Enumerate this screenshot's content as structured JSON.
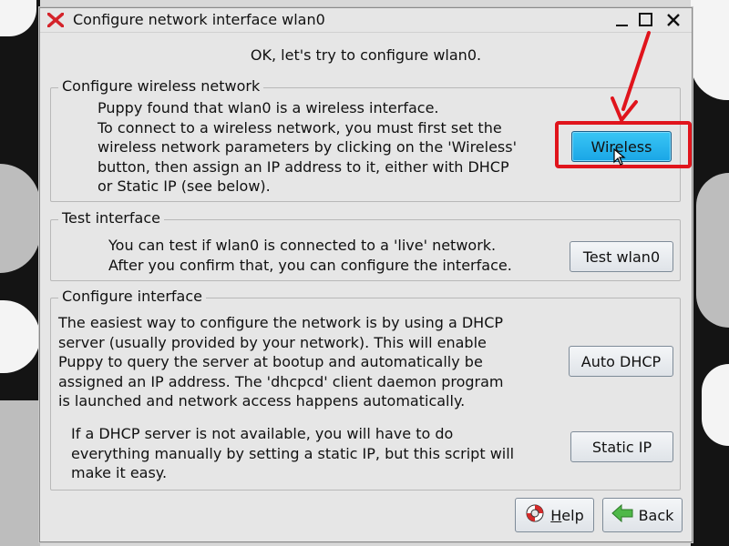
{
  "window": {
    "title": "Configure network interface wlan0"
  },
  "intro": "OK, let's try to configure wlan0.",
  "wireless_section": {
    "label": "Configure wireless network",
    "lines": [
      "Puppy found that wlan0 is a wireless interface.",
      "To connect to a wireless network, you must first set the",
      "wireless network parameters by clicking on the 'Wireless'",
      "button, then assign an IP address to it, either with DHCP",
      "or Static IP (see below)."
    ],
    "button": "Wireless"
  },
  "test_section": {
    "label": "Test interface",
    "lines": [
      "You can test if wlan0 is connected to a 'live' network.",
      "After you confirm that, you can configure the interface."
    ],
    "button": "Test wlan0"
  },
  "configure_section": {
    "label": "Configure interface",
    "dhcp_lines": [
      "The easiest way to configure the network is by using a DHCP",
      "server (usually provided by your network). This will enable",
      "Puppy to query the server at bootup and automatically be",
      "assigned an IP address. The 'dhcpcd' client daemon program",
      "is launched and network access happens automatically."
    ],
    "dhcp_button": "Auto DHCP",
    "static_lines": [
      "If a DHCP server is not available, you will have to do",
      "everything manually by setting a static IP, but this script will",
      "make it easy."
    ],
    "static_button": "Static IP"
  },
  "footer": {
    "help_first": "H",
    "help_rest": "elp",
    "back": "Back"
  },
  "colors": {
    "highlight": "#e0141c",
    "active_button": "#1aa6e6"
  },
  "icons": {
    "app": "puppy-x-icon",
    "help": "lifebuoy-icon",
    "back": "green-left-arrow-icon",
    "cursor": "mouse-pointer-icon"
  }
}
